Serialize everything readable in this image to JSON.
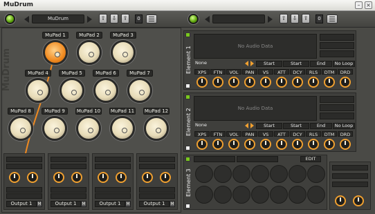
{
  "window": {
    "title": "MuDrum",
    "minimize": "–",
    "close": "×"
  },
  "left_top": {
    "preset_name": "MuDrum",
    "channel": "0"
  },
  "right_top": {
    "preset_name": "",
    "channel": "0"
  },
  "watermark": "MuDrum",
  "pads": [
    {
      "label": "MuPad 1"
    },
    {
      "label": "MuPad 2"
    },
    {
      "label": "MuPad 3"
    },
    {
      "label": "MuPad 4"
    },
    {
      "label": "MuPad 5"
    },
    {
      "label": "MuPad 6"
    },
    {
      "label": "MuPad 7"
    },
    {
      "label": "MuPad 8"
    },
    {
      "label": "MuPad 9"
    },
    {
      "label": "MuPad 10"
    },
    {
      "label": "MuPad 11"
    },
    {
      "label": "MuPad 12"
    }
  ],
  "outputs": [
    {
      "label": "Output 1",
      "mute": "M"
    },
    {
      "label": "Output 1",
      "mute": "M"
    },
    {
      "label": "Output 1",
      "mute": "M"
    },
    {
      "label": "Output 1",
      "mute": "M"
    }
  ],
  "elements": [
    {
      "name": "Element 1",
      "wave_text": "No Audio Data",
      "mode": "None",
      "start_a": "Start",
      "start_b": "Start",
      "end": "End",
      "loop": "No Loop",
      "params": [
        "XPS",
        "FTN",
        "VOL",
        "PAN",
        "VS",
        "ATT",
        "DCY",
        "RLS",
        "DTM",
        "DRD"
      ]
    },
    {
      "name": "Element 2",
      "wave_text": "No Audio Data",
      "mode": "None",
      "start_a": "Start",
      "start_b": "Start",
      "end": "End",
      "loop": "No Loop",
      "params": [
        "XPS",
        "FTN",
        "VOL",
        "PAN",
        "VS",
        "ATT",
        "DCY",
        "RLS",
        "DTM",
        "DRD"
      ]
    },
    {
      "name": "Element 3",
      "edit": "EDIT"
    }
  ],
  "colors": {
    "accent": "#f0a030",
    "led": "#7ac81e",
    "panel": "#4f4f4b"
  }
}
